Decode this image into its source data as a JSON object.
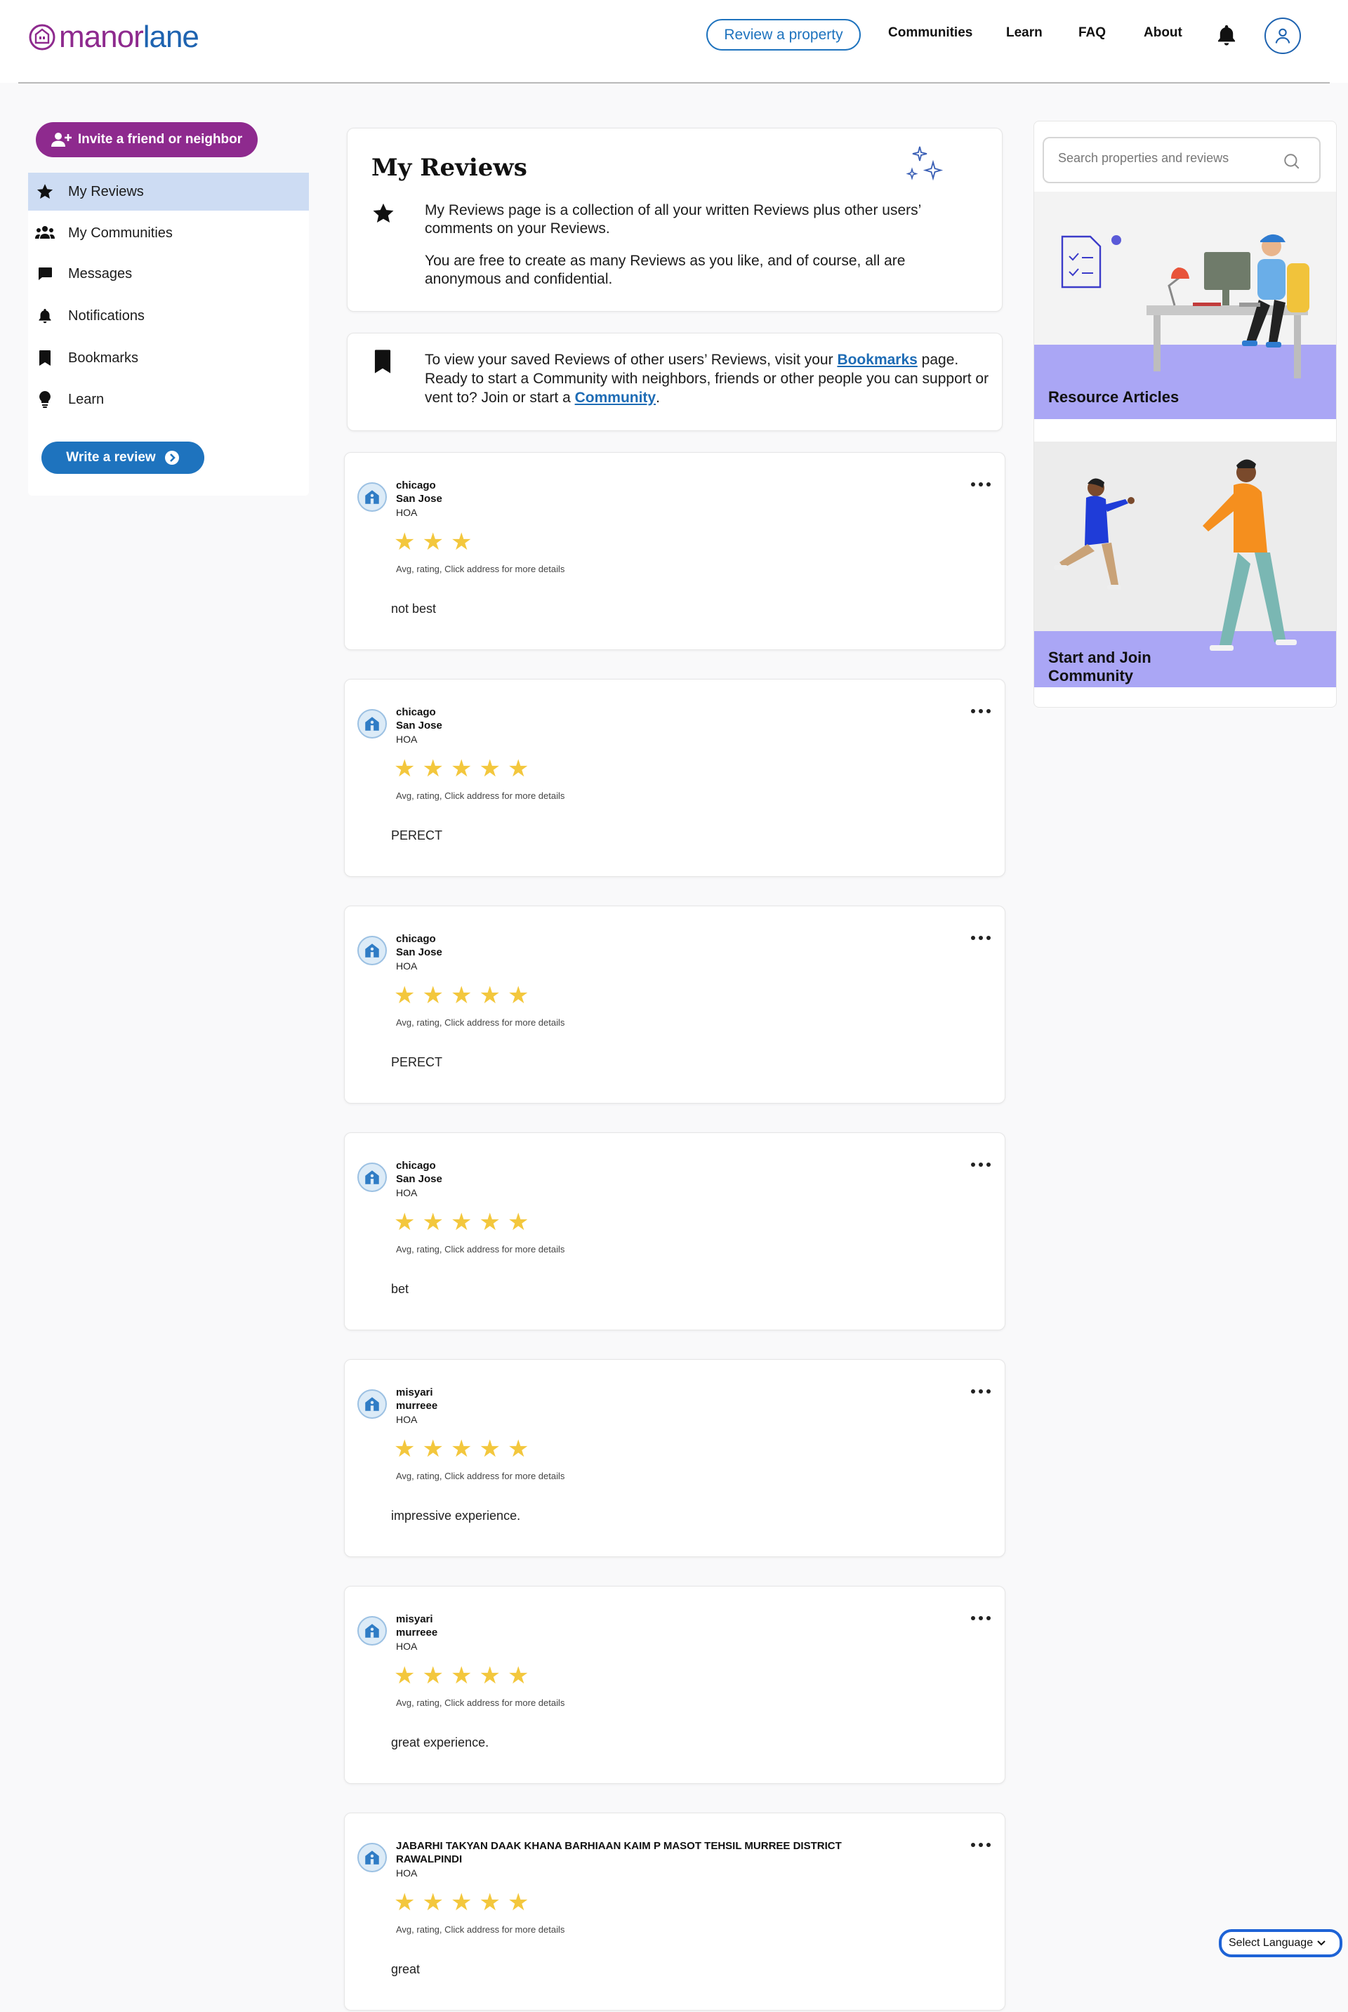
{
  "brand": {
    "name_part1": "manor",
    "name_part2": "lane"
  },
  "nav": {
    "review_button": "Review a property",
    "links": [
      "Communities",
      "Learn",
      "FAQ",
      "About"
    ]
  },
  "sidebar": {
    "invite_label": "Invite a friend or neighbor",
    "items": [
      {
        "label": "My Reviews",
        "icon": "star-icon",
        "active": true
      },
      {
        "label": "My Communities",
        "icon": "users-icon",
        "active": false
      },
      {
        "label": "Messages",
        "icon": "message-icon",
        "active": false
      },
      {
        "label": "Notifications",
        "icon": "bell-icon",
        "active": false
      },
      {
        "label": "Bookmarks",
        "icon": "bookmark-icon",
        "active": false
      },
      {
        "label": "Learn",
        "icon": "lightbulb-icon",
        "active": false
      }
    ],
    "write_review_label": "Write a review"
  },
  "intro": {
    "title": "My Reviews",
    "p1": "My Reviews page is a collection of all your written Reviews plus other users’ comments on your Reviews.",
    "p2": "You are free to create as many Reviews as you like, and of course, all are anonymous and confidential."
  },
  "bookmark_info": {
    "text_before_link1": "To view your saved Reviews of other users’ Reviews, visit your ",
    "link1": "Bookmarks",
    "text_after_link1": " page. Ready to start a Community with neighbors, friends or other people you can support or vent to? Join or start a ",
    "link2": "Community",
    "text_end": "."
  },
  "reviews": [
    {
      "line1": "chicago",
      "line2": "San Jose",
      "type": "HOA",
      "rating": 3,
      "hint": "Avg, rating, Click address for more details",
      "text": "not best"
    },
    {
      "line1": "chicago",
      "line2": "San Jose",
      "type": "HOA",
      "rating": 5,
      "hint": "Avg, rating, Click address for more details",
      "text": "PERECT"
    },
    {
      "line1": "chicago",
      "line2": "San Jose",
      "type": "HOA",
      "rating": 5,
      "hint": "Avg, rating, Click address for more details",
      "text": "PERECT"
    },
    {
      "line1": "chicago",
      "line2": "San Jose",
      "type": "HOA",
      "rating": 5,
      "hint": "Avg, rating, Click address for more details",
      "text": "bet"
    },
    {
      "line1": "misyari",
      "line2": "murreee",
      "type": "HOA",
      "rating": 5,
      "hint": "Avg, rating, Click address for more details",
      "text": "impressive experience."
    },
    {
      "line1": "misyari",
      "line2": "murreee",
      "type": "HOA",
      "rating": 5,
      "hint": "Avg, rating, Click address for more details",
      "text": "great experience."
    },
    {
      "line1": "JABARHI TAKYAN DAAK KHANA BARHIAAN KAIM P MASOT TEHSIL MURREE DISTRICT",
      "line2": "RAWALPINDI",
      "type": "HOA",
      "rating": 5,
      "hint": "Avg, rating, Click address for more details",
      "text": "great"
    }
  ],
  "search": {
    "placeholder": "Search properties and reviews"
  },
  "promos": {
    "articles": "Resource Articles",
    "community_line1": "Start and Join",
    "community_line2": "Community"
  },
  "language": {
    "label": "Select Language"
  },
  "colors": {
    "brand_purple": "#8e2a8e",
    "brand_blue": "#1e63b0",
    "star": "#f3c73d",
    "promo_band": "#aaa6f5",
    "active_item": "#cddcf3"
  }
}
